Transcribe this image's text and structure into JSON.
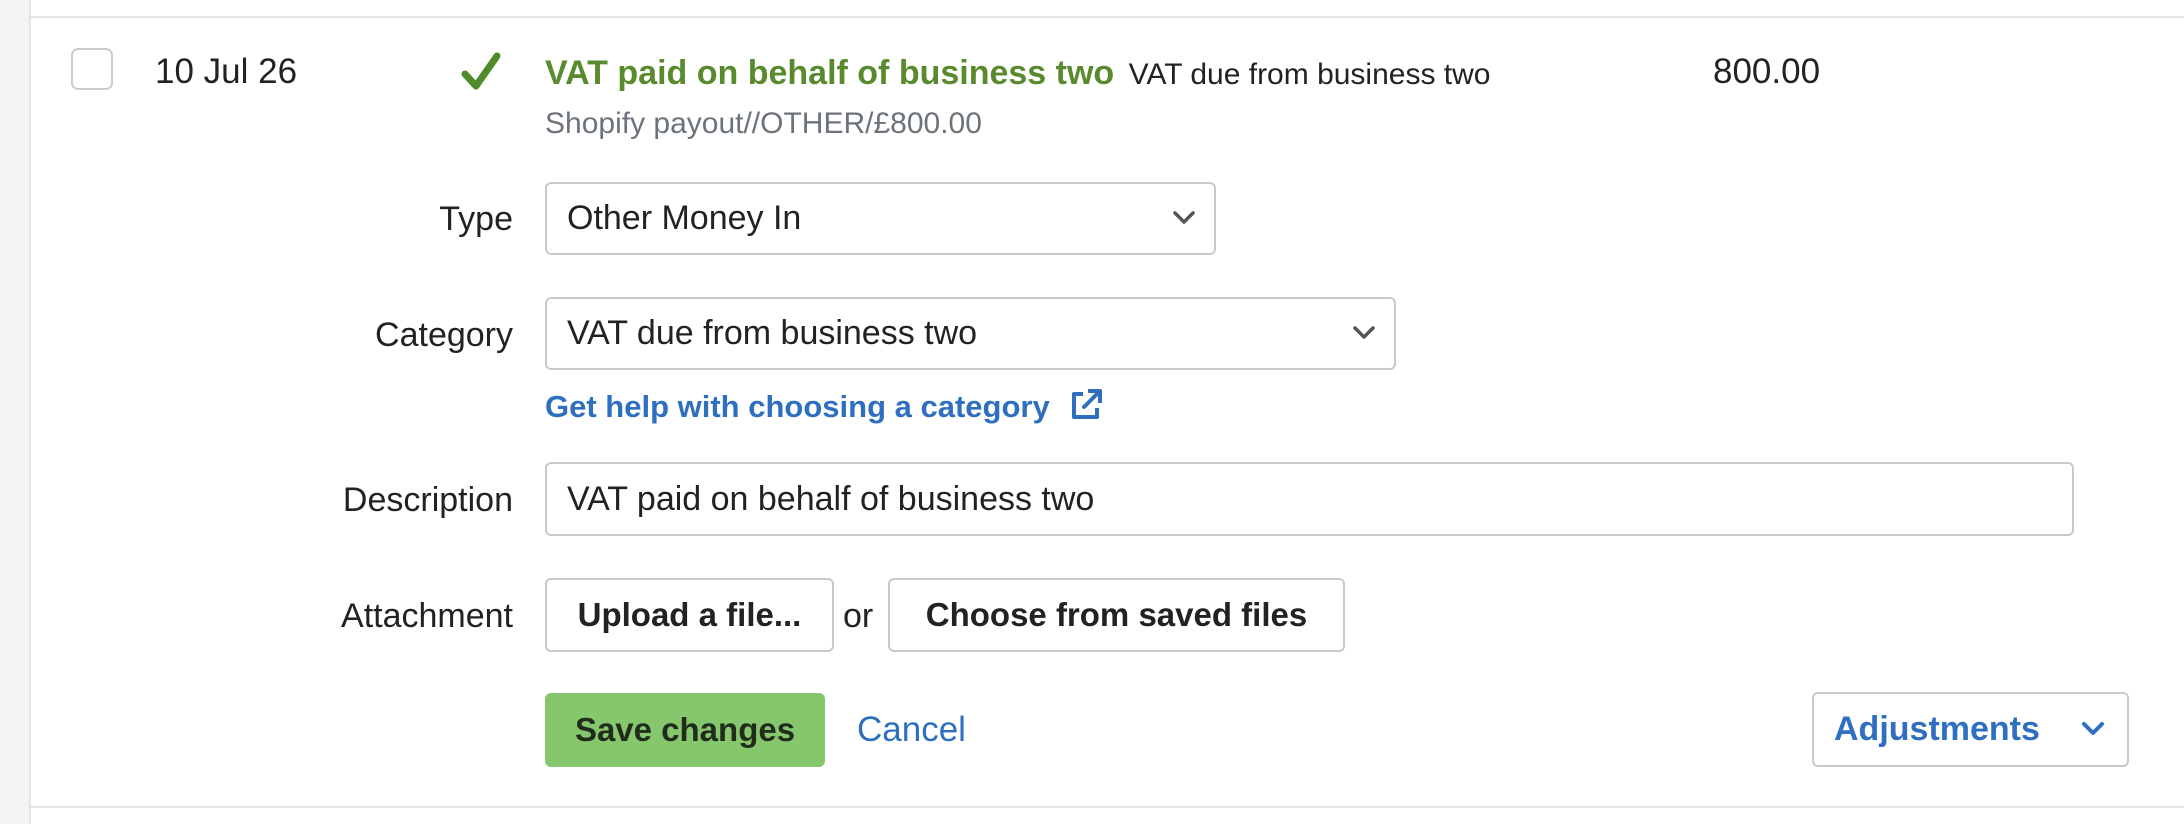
{
  "transaction": {
    "date": "10 Jul 26",
    "title": "VAT paid on behalf of business two",
    "category_inline": "VAT due from business two",
    "amount": "800.00",
    "subline": "Shopify payout//OTHER/£800.00"
  },
  "form": {
    "type_label": "Type",
    "type_value": "Other Money In",
    "category_label": "Category",
    "category_value": "VAT due from business two",
    "help_link": "Get help with choosing a category",
    "description_label": "Description",
    "description_value": "VAT paid on behalf of business two",
    "attachment_label": "Attachment",
    "upload_button": "Upload a file...",
    "or_text": "or",
    "choose_button": "Choose from saved files"
  },
  "actions": {
    "save": "Save changes",
    "cancel": "Cancel",
    "adjustments": "Adjustments"
  },
  "colors": {
    "accent_green": "#5a8a2e",
    "save_green": "#86c76e",
    "link_blue": "#2f6fbf"
  },
  "icons": {
    "status": "check-icon",
    "help": "external-link-icon",
    "dropdown": "chevron-down-icon"
  }
}
